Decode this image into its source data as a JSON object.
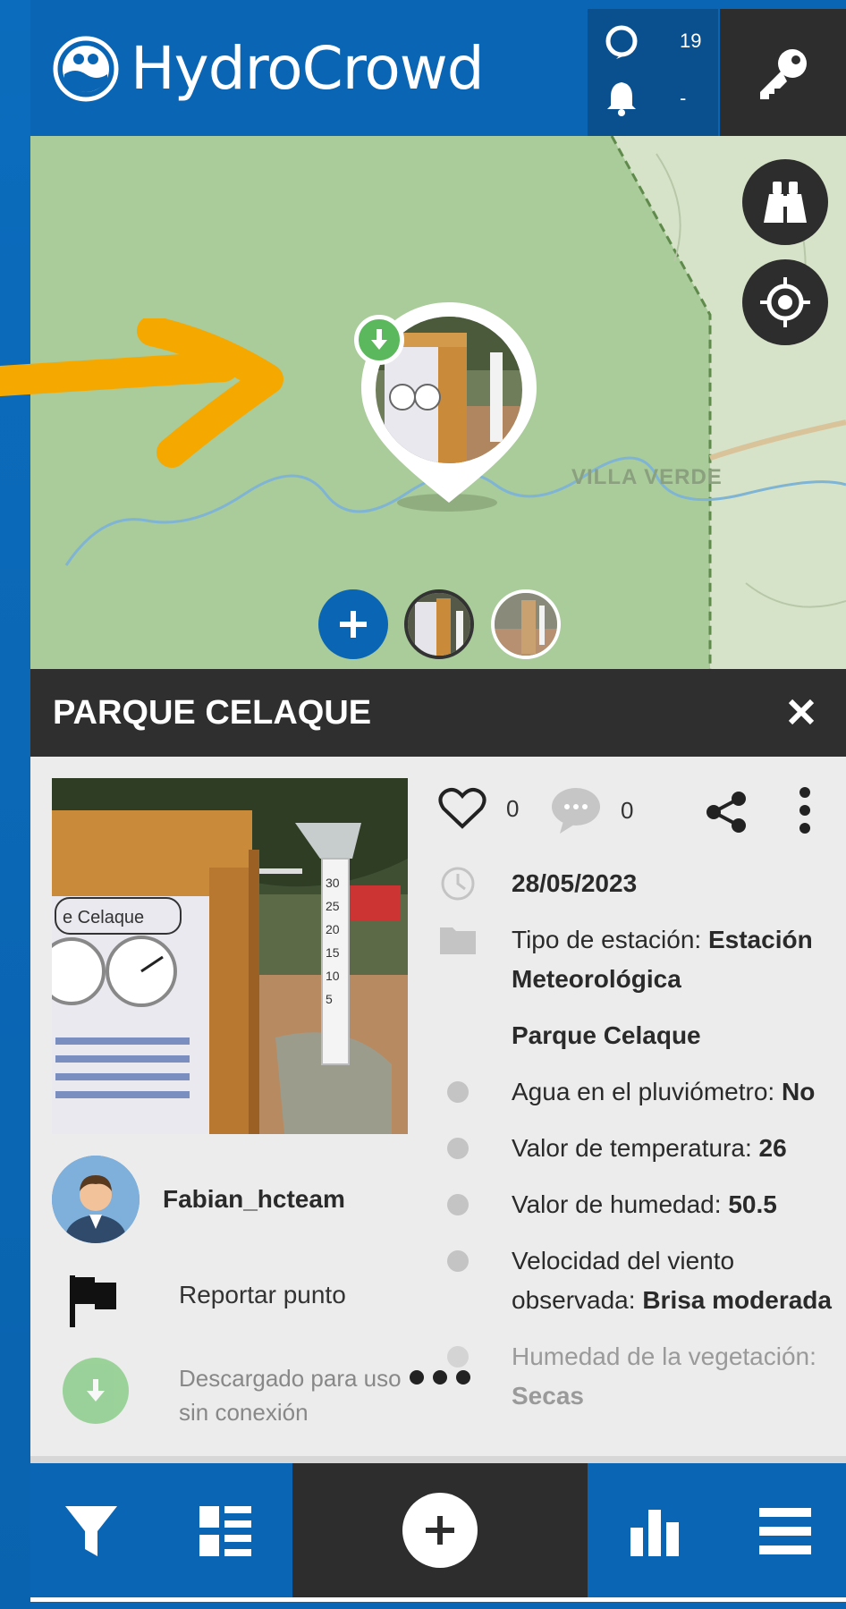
{
  "app": {
    "name": "HydroCrowd"
  },
  "header": {
    "stats": [
      {
        "icon": "drop-icon",
        "value": "19"
      },
      {
        "icon": "bell-icon",
        "value": "-"
      }
    ],
    "login_icon": "key-icon"
  },
  "map": {
    "place_label": "VILLA VERDE",
    "buttons": [
      "binoculars-icon",
      "locate-icon"
    ]
  },
  "panel": {
    "title": "PARQUE CELAQUE",
    "likes": "0",
    "comments": "0",
    "date": "28/05/2023",
    "station_type_label": "Tipo de estación: ",
    "station_type_value": "Estación Meteorológica",
    "location_name": "Parque Celaque",
    "fields": [
      {
        "label": "Agua en el pluviómetro: ",
        "value": "No"
      },
      {
        "label": "Valor de temperatura: ",
        "value": "26"
      },
      {
        "label": "Valor de humedad: ",
        "value": "50.5"
      },
      {
        "label": "Velocidad del viento observada: ",
        "value": "Brisa moderada"
      },
      {
        "label": "Humedad de la vegetación: ",
        "value": "Secas"
      }
    ],
    "user": "Fabian_hcteam",
    "report_label": "Reportar punto",
    "offline_label": "Descargado para uso sin conexión"
  },
  "bottom_nav": [
    "filter-icon",
    "list-icon",
    "add-icon",
    "chart-icon",
    "menu-icon"
  ],
  "colors": {
    "primary": "#0a66b4",
    "dark": "#2d2d2d",
    "map_green": "#aacb9a",
    "accent_orange": "#f5a800",
    "badge_green": "#5cb85c"
  }
}
